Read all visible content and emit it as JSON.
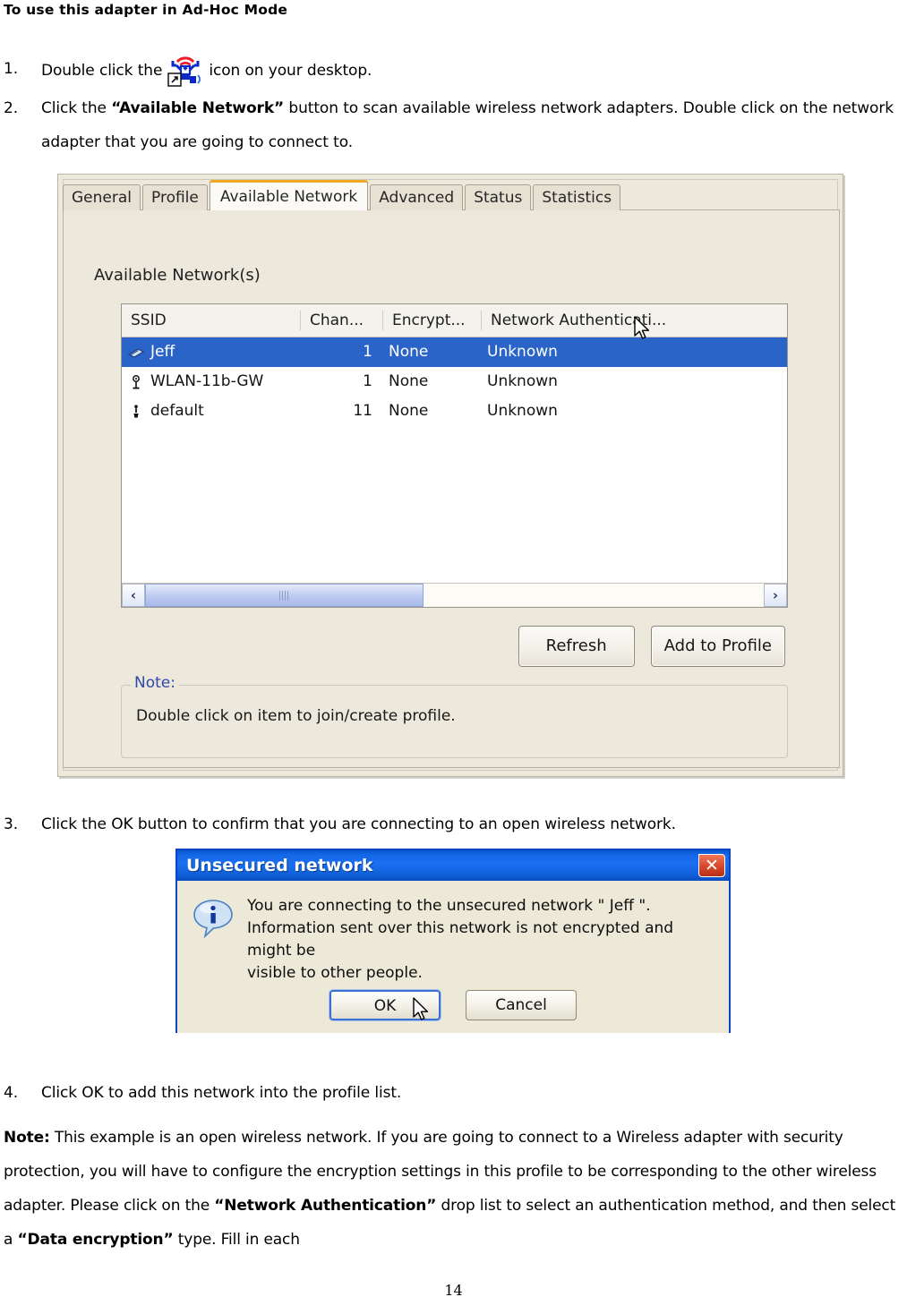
{
  "heading": "To use this adapter in Ad-Hoc Mode",
  "steps": {
    "s1": {
      "num": "1.",
      "before": "Double click the",
      "after": "icon on your desktop.",
      "icon": "wireless-adapter-shortcut-icon"
    },
    "s2": {
      "num": "2.",
      "part1": "Click the ",
      "bold1": "“Available Network”",
      "part2": " button to scan available wireless network adapters. Double click on the network adapter that you are going to connect to."
    },
    "s3": {
      "num": "3.",
      "text": "Click the OK button to confirm that you are connecting to an open wireless network."
    },
    "s4": {
      "num": "4.",
      "text": "Click OK to add this network into the profile list."
    }
  },
  "note_paragraph": {
    "label": "Note:",
    "part1": " This example is an open wireless network. If you are going to connect to a Wireless adapter with security protection, you will have to configure the encryption settings in this profile to be corresponding to the other wireless adapter. Please click on the ",
    "bold1": "“Network Authentication”",
    "part2": " drop list to select an authentication method, and then select a ",
    "bold2": "“Data encryption”",
    "part3": " type. Fill in each"
  },
  "page_number": "14",
  "utility": {
    "tabs": [
      {
        "label": "General",
        "active": false
      },
      {
        "label": "Profile",
        "active": false
      },
      {
        "label": "Available Network",
        "active": true
      },
      {
        "label": "Advanced",
        "active": false
      },
      {
        "label": "Status",
        "active": false
      },
      {
        "label": "Statistics",
        "active": false
      }
    ],
    "section_label": "Available Network(s)",
    "columns": [
      "SSID",
      "Chan...",
      "Encrypt...",
      "Network Authenticati..."
    ],
    "rows": [
      {
        "icon": "adhoc-card-icon",
        "ssid": "Jeff",
        "chan": "1",
        "encrypt": "None",
        "auth": "Unknown",
        "selected": true
      },
      {
        "icon": "access-point-icon",
        "ssid": "WLAN-11b-GW",
        "chan": "1",
        "encrypt": "None",
        "auth": "Unknown",
        "selected": false
      },
      {
        "icon": "tower-icon",
        "ssid": "default",
        "chan": "11",
        "encrypt": "None",
        "auth": "Unknown",
        "selected": false
      }
    ],
    "scrollbar": {
      "left_arrow": "‹",
      "right_arrow": "›"
    },
    "buttons": {
      "refresh": "Refresh",
      "add_to_profile": "Add to Profile"
    },
    "note_group": {
      "title": "Note:",
      "text": "Double click on item to join/create profile."
    },
    "colors": {
      "selection": "#2a64c8",
      "active_tab_accent": "#eda924",
      "dialog_face": "#ece8dc",
      "note_title": "#2e49a8"
    }
  },
  "unsecured_dialog": {
    "title": "Unsecured network",
    "close_label": "✕",
    "icon": "info-balloon-icon",
    "message_line1": "You are connecting to the unsecured network \" Jeff \".",
    "message_line2": "Information sent over this network is not encrypted and might be",
    "message_line3": "visible to other people.",
    "ok_label": "OK",
    "cancel_label": "Cancel",
    "colors": {
      "titlebar": "#1568e8",
      "close": "#d8472a",
      "face": "#ece9d8"
    }
  }
}
